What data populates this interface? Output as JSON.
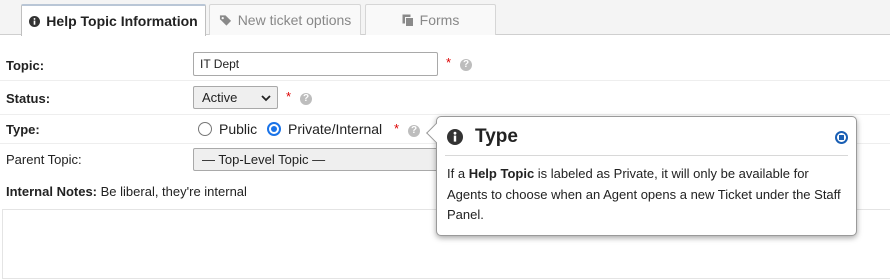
{
  "tabs": [
    {
      "label": "Help Topic Information",
      "icon": "info-icon",
      "active": true
    },
    {
      "label": "New ticket options",
      "icon": "tag-icon",
      "active": false
    },
    {
      "label": "Forms",
      "icon": "copy-icon",
      "active": false
    }
  ],
  "form": {
    "topic": {
      "label": "Topic:",
      "value": "IT Dept",
      "required": "*"
    },
    "status": {
      "label": "Status:",
      "value": "Active",
      "required": "*"
    },
    "type": {
      "label": "Type:",
      "options": [
        "Public",
        "Private/Internal"
      ],
      "selected": "Private/Internal",
      "required": "*"
    },
    "parent": {
      "label": "Parent Topic:",
      "value": "— Top-Level Topic —"
    },
    "notes": {
      "label": "Internal Notes:",
      "text": "Be liberal, they're internal"
    }
  },
  "popover": {
    "title": "Type",
    "body": {
      "p1": "If a ",
      "strong": "Help Topic",
      "p2": " is labeled as Private, it will only be available for Agents to choose when an Agent opens a new Ticket under the Staff Panel."
    }
  },
  "colors": {
    "required": "#dd0000",
    "radio_selected": "#1a73e8",
    "close_icon": "#1a5fb4"
  }
}
